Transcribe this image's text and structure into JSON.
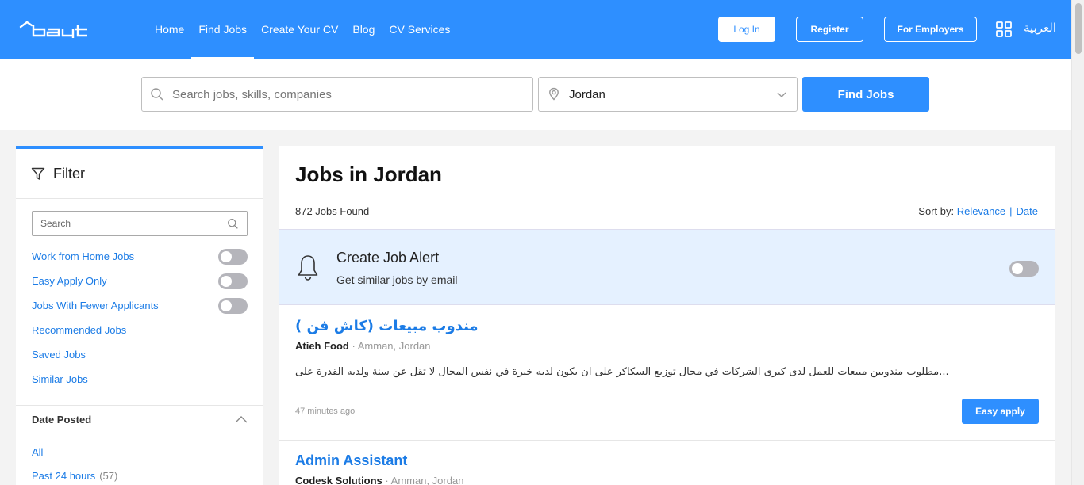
{
  "brand": {
    "logo_text": "bayt",
    "accent": "#2e8fff",
    "link": "#1c7ce6"
  },
  "nav": {
    "items": [
      {
        "label": "Home"
      },
      {
        "label": "Find Jobs",
        "active": true
      },
      {
        "label": "Create Your CV"
      },
      {
        "label": "Blog"
      },
      {
        "label": "CV Services"
      }
    ]
  },
  "header": {
    "login_label": "Log In",
    "register_label": "Register",
    "employers_label": "For Employers",
    "apps_icon": "grid-icon",
    "language_label": "العربية"
  },
  "search": {
    "keyword_placeholder": "Search jobs, skills, companies",
    "keyword_value": "",
    "location_value": "Jordan",
    "find_label": "Find Jobs"
  },
  "filter": {
    "title": "Filter",
    "search_placeholder": "Search",
    "options": [
      {
        "label": "Work from Home Jobs",
        "toggle": false
      },
      {
        "label": "Easy Apply Only",
        "toggle": false
      },
      {
        "label": "Jobs With Fewer Applicants",
        "toggle": false
      },
      {
        "label": "Recommended Jobs"
      },
      {
        "label": "Saved Jobs"
      },
      {
        "label": "Similar Jobs"
      }
    ],
    "date_posted": {
      "title": "Date Posted",
      "items": [
        {
          "label": "All",
          "count": ""
        },
        {
          "label": "Past 24 hours",
          "count": "(57)"
        }
      ]
    }
  },
  "main": {
    "title": "Jobs in Jordan",
    "jobs_found": "872 Jobs Found",
    "sort_label": "Sort by:",
    "sort_relevance": "Relevance",
    "sort_separator": "|",
    "sort_date": "Date",
    "alert": {
      "title": "Create Job Alert",
      "subtitle": "Get similar jobs by email",
      "enabled": false
    },
    "jobs": [
      {
        "title": "مندوب مبيعات (كاش فن )",
        "company": "Atieh Food",
        "location": "Amman, Jordan",
        "description": "مطلوب مندوبين مبيعات للعمل لدى كبرى الشركات في مجال توزيع السكاكر على ان يكون لديه خبرة في نفس المجال لا تقل عن سنة ولديه القدرة على...",
        "posted": "47 minutes ago",
        "apply_label": "Easy apply"
      },
      {
        "title": "Admin Assistant",
        "company": "Codesk Solutions",
        "location": "Amman, Jordan"
      }
    ]
  }
}
